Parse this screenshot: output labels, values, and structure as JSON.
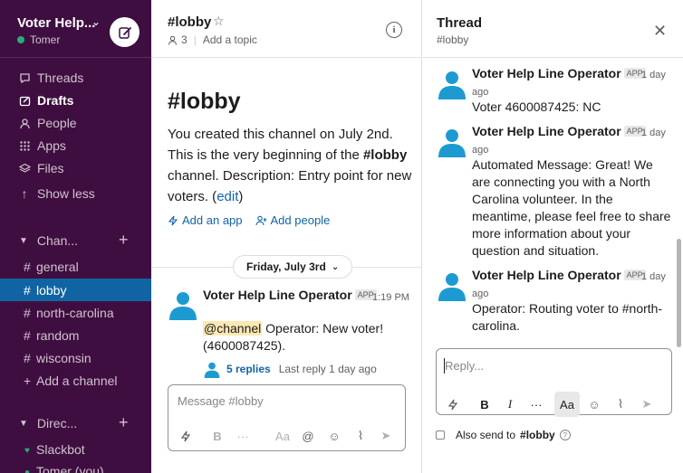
{
  "workspace": {
    "name": "Voter Help...",
    "user": "Tomer"
  },
  "sidebar": {
    "nav": [
      {
        "label": "Threads"
      },
      {
        "label": "Drafts"
      },
      {
        "label": "People"
      },
      {
        "label": "Apps"
      },
      {
        "label": "Files"
      },
      {
        "label": "Show less"
      }
    ],
    "channels_header": "Chan...",
    "channels": [
      {
        "label": "general"
      },
      {
        "label": "lobby"
      },
      {
        "label": "north-carolina"
      },
      {
        "label": "random"
      },
      {
        "label": "wisconsin"
      }
    ],
    "add_channel": "Add a channel",
    "dms_header": "Direc...",
    "dms": [
      {
        "label": "Slackbot"
      },
      {
        "label": "Tomer"
      }
    ],
    "dm_you": "(you)"
  },
  "channel": {
    "title": "#lobby",
    "member_count": "3",
    "add_topic": "Add a topic",
    "intro_title": "#lobby",
    "intro_part1": "You created this channel on July 2nd. This is the very beginning of the ",
    "intro_channel": "#lobby",
    "intro_part2": " channel. Description: Entry point for new voters. (",
    "intro_edit": "edit",
    "intro_close": ")",
    "add_app": "Add an app",
    "add_people": "Add people",
    "day_label": "Friday, July 3rd",
    "message": {
      "author": "Voter Help Line Operator",
      "badge": "APP",
      "time": "1:19 PM",
      "mention": "@channel",
      "body": " Operator: New voter! (4600087425).",
      "replies": "5 replies",
      "last_reply": "Last reply 1 day ago"
    },
    "composer_placeholder": "Message #lobby"
  },
  "thread": {
    "title": "Thread",
    "subtitle": "#lobby",
    "messages": [
      {
        "author": "Voter Help Line Operator",
        "badge": "APP",
        "time": "1 day ago",
        "body": "Voter 4600087425: NC"
      },
      {
        "author": "Voter Help Line Operator",
        "badge": "APP",
        "time": "1 day ago",
        "body": "Automated Message: Great! We are connecting you with a North Carolina volunteer. In the meantime, please feel free to share more information about your question and situation."
      },
      {
        "author": "Voter Help Line Operator",
        "badge": "APP",
        "time": "1 day ago",
        "body": "Operator: Routing voter to #north-carolina."
      }
    ],
    "reply_placeholder": "Reply...",
    "also_send": "Also send to",
    "also_send_channel": "#lobby"
  },
  "colors": {
    "sidebar_bg": "#3f0e40",
    "active_channel": "#1164a3",
    "link": "#1264a3",
    "presence": "#2bac76",
    "avatar": "#1d9bd1"
  }
}
